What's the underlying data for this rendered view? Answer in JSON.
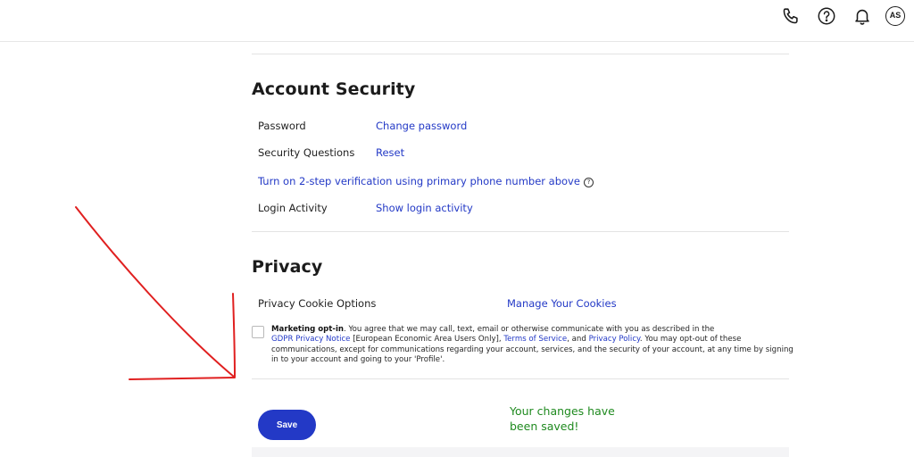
{
  "header": {
    "icons": [
      "phone-icon",
      "help-icon",
      "bell-icon"
    ],
    "avatar_initials": "AS"
  },
  "account_security": {
    "title": "Account Security",
    "rows": [
      {
        "label": "Password",
        "link": "Change password"
      },
      {
        "label": "Security Questions",
        "link": "Reset"
      }
    ],
    "two_step_link": "Turn on 2-step verification using primary phone number above",
    "login_activity": {
      "label": "Login Activity",
      "link": "Show login activity"
    }
  },
  "privacy": {
    "title": "Privacy",
    "cookie_label": "Privacy Cookie Options",
    "cookie_link": "Manage Your Cookies",
    "optin": {
      "checked": false,
      "heading": "Marketing opt-in",
      "text_1": ". You agree that we may call, text, email or otherwise communicate with you as described in the",
      "gdpr_link": "GDPR Privacy Notice",
      "text_2": " [European Economic Area Users Only], ",
      "tos_link": "Terms of Service",
      "text_3": ", and ",
      "privacy_link": "Privacy Policy",
      "text_4": ". You may opt-out of these communications, except for communications regarding your account, services, and the security of your account, at any time by signing in to your account and going to your 'Profile'."
    }
  },
  "actions": {
    "save_label": "Save",
    "saved_message": "Your changes have been saved!"
  },
  "colors": {
    "accent": "#2339c6",
    "success": "#1f8a1f",
    "annotation": "#e02020"
  }
}
